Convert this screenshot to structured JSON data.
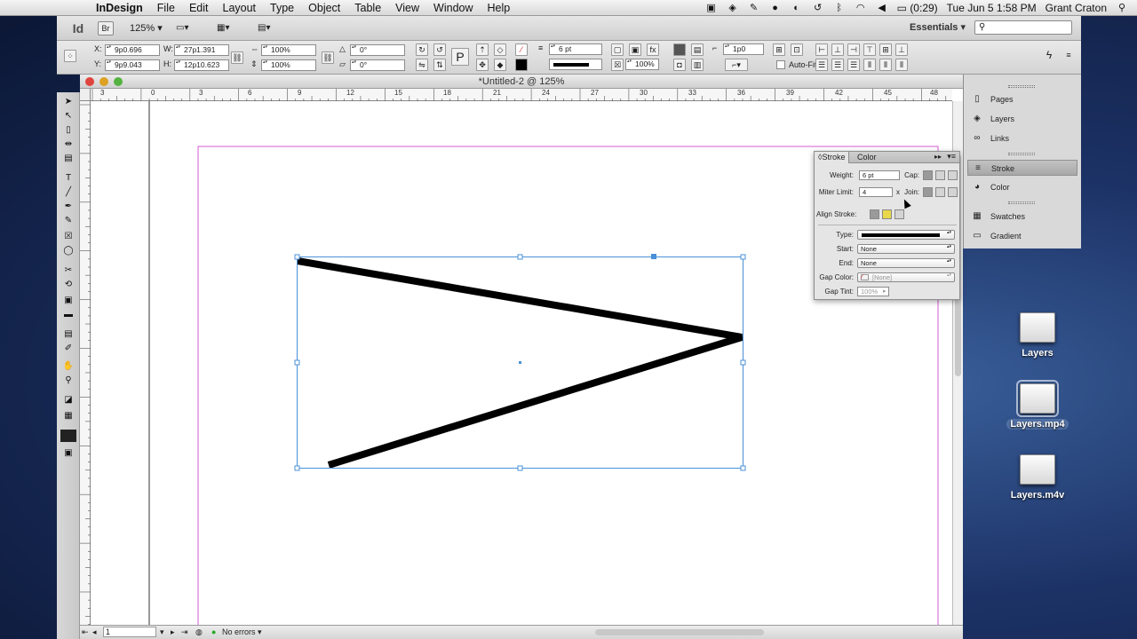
{
  "menubar": {
    "app_name": "InDesign",
    "menus": [
      "File",
      "Edit",
      "Layout",
      "Type",
      "Object",
      "Table",
      "View",
      "Window",
      "Help"
    ],
    "battery": "(0:29)",
    "datetime": "Tue Jun 5  1:58 PM",
    "user": "Grant Craton"
  },
  "appbar": {
    "logo": "Id",
    "zoom": "125%",
    "workspace": "Essentials",
    "search_placeholder": "",
    "bridge_label": "Br"
  },
  "control": {
    "x_label": "X:",
    "x_value": "9p0.696",
    "y_label": "Y:",
    "y_value": "9p9.043",
    "w_label": "W:",
    "w_value": "27p1.391",
    "h_label": "H:",
    "h_value": "12p10.623",
    "scale_x": "100%",
    "scale_y": "100%",
    "rotate": "0°",
    "shear": "0°",
    "stroke_weight": "6 pt",
    "opacity": "100%",
    "offset": "1p0",
    "autofit_label": "Auto-Fit"
  },
  "document": {
    "title": "*Untitled-2 @ 125%",
    "ruler_labels": [
      "3",
      "0",
      "3",
      "6",
      "9",
      "12",
      "15",
      "18",
      "21",
      "24",
      "27",
      "30",
      "33",
      "36",
      "39",
      "42",
      "45",
      "48"
    ],
    "page_number": "1",
    "errors_label": "No errors"
  },
  "stroke_panel": {
    "tabs": [
      "Stroke",
      "Color"
    ],
    "weight_label": "Weight:",
    "weight_value": "6 pt",
    "cap_label": "Cap:",
    "miter_label": "Miter Limit:",
    "miter_value": "4",
    "miter_x": "x",
    "join_label": "Join:",
    "align_label": "Align Stroke:",
    "type_label": "Type:",
    "start_label": "Start:",
    "start_value": "None",
    "end_label": "End:",
    "end_value": "None",
    "gap_color_label": "Gap Color:",
    "gap_color_value": "[None]",
    "gap_tint_label": "Gap Tint:",
    "gap_tint_value": "100%"
  },
  "dock": {
    "items": [
      "Pages",
      "Layers",
      "Links",
      "Stroke",
      "Color",
      "Swatches",
      "Gradient"
    ]
  },
  "desktop": {
    "icons": [
      "Layers",
      "Layers.mp4",
      "Layers.m4v"
    ]
  },
  "colors": {
    "selection": "#4a90d9",
    "page_margin": "#d65ad6",
    "stroke": "#000000"
  }
}
